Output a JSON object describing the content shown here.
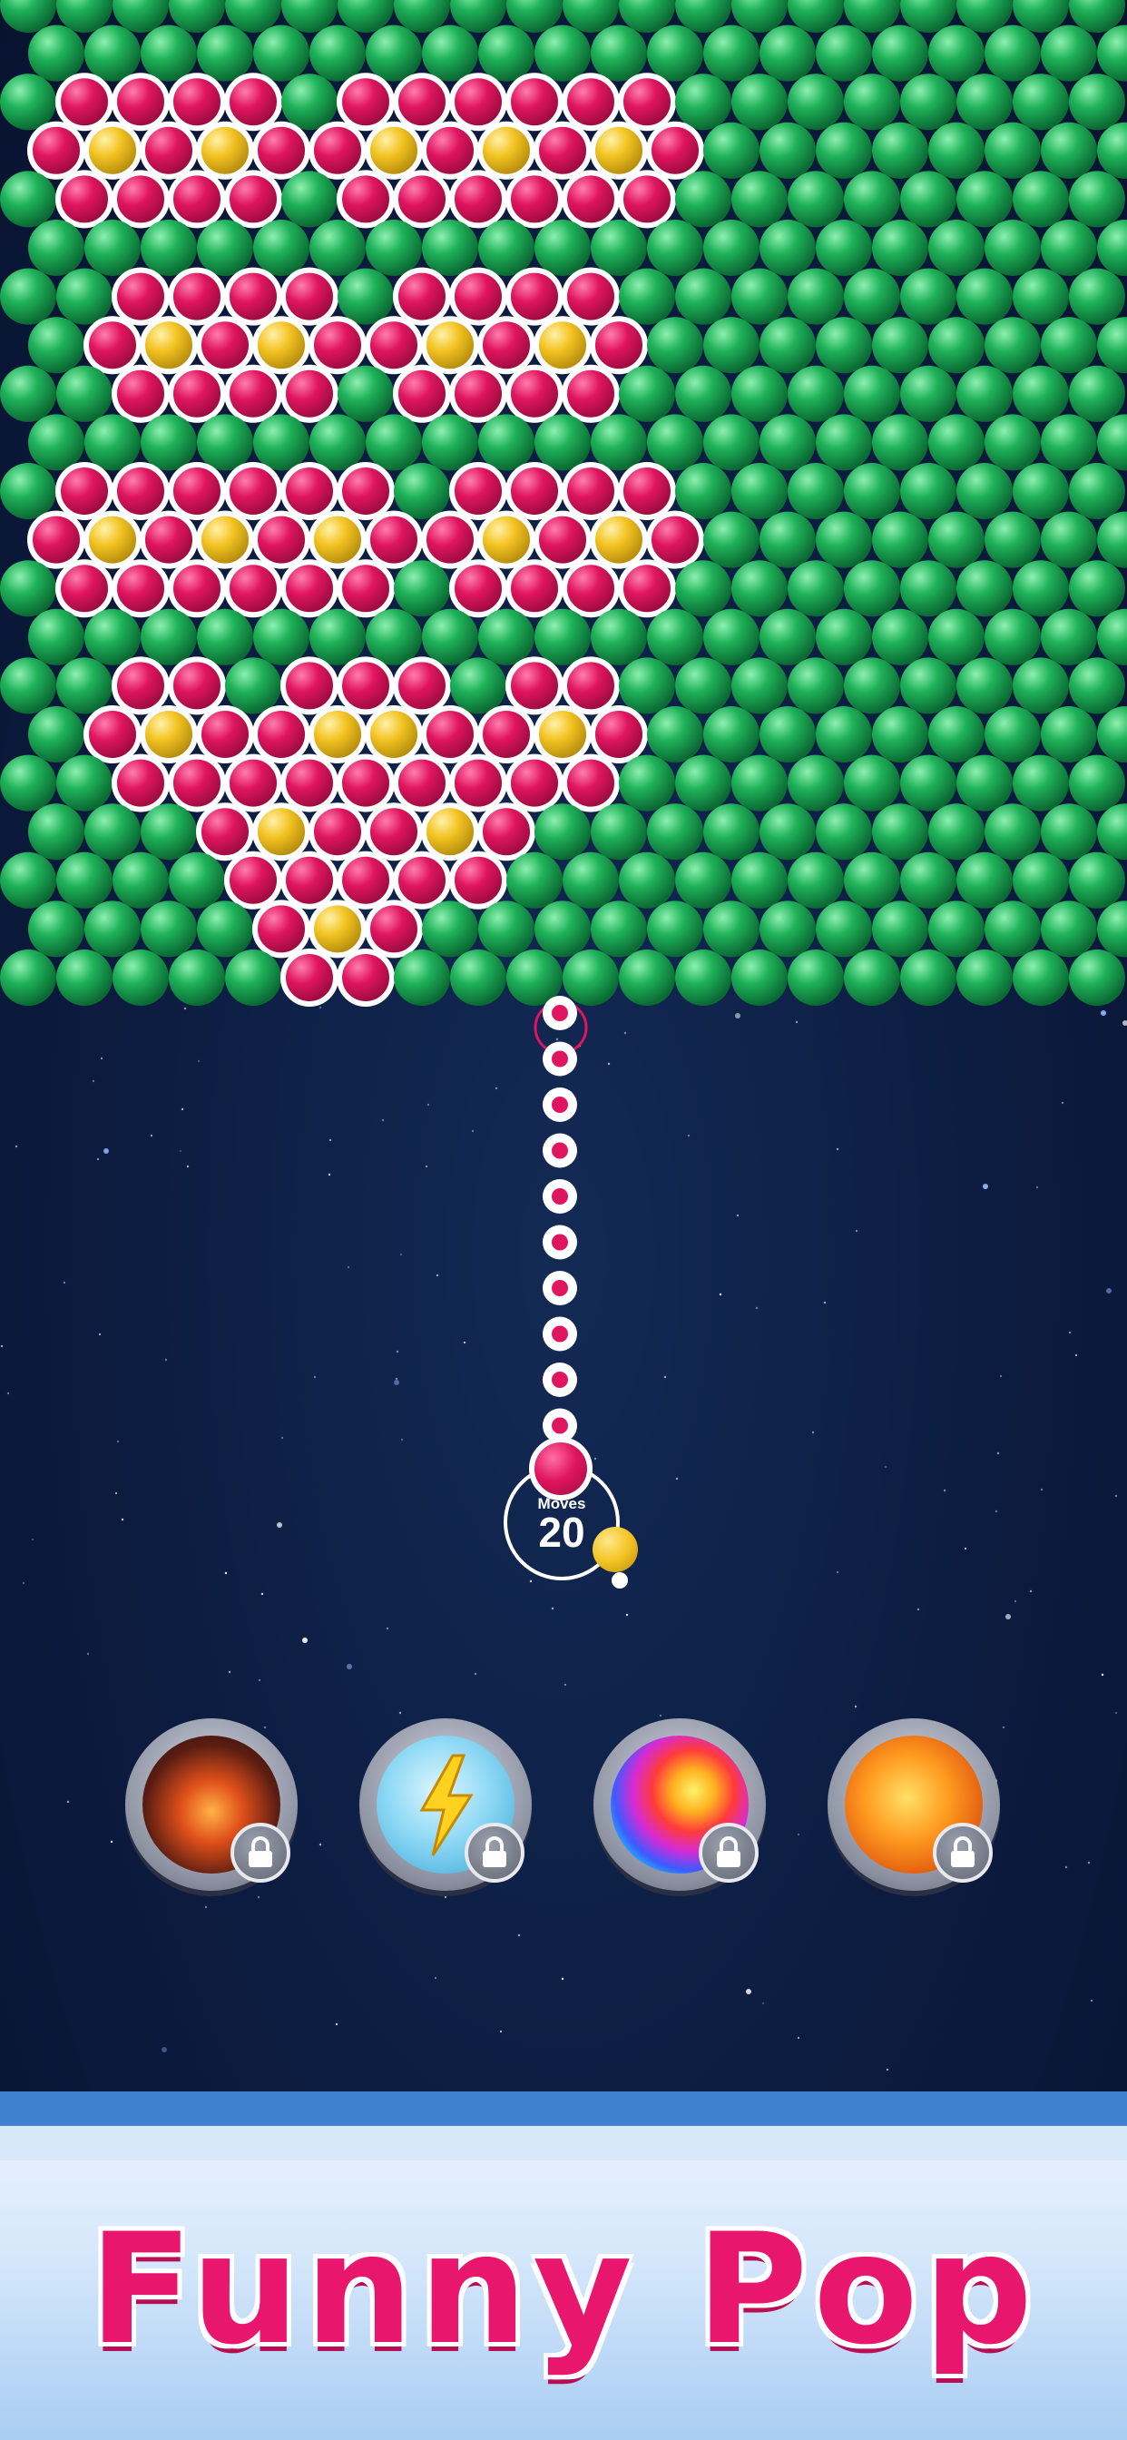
{
  "game": {
    "moves_label": "Moves",
    "moves_value": "20",
    "shooter_color": "pink",
    "next_ball_color": "yellow",
    "board": {
      "bubble_colors": {
        "green": "#1fb25a",
        "pink": "#e0155f",
        "yellow": "#f3c322"
      },
      "pattern": "pink-and-yellow flowers on green bubble field"
    }
  },
  "boosters": [
    {
      "name": "bomb",
      "icon": "bomb-icon",
      "locked": true
    },
    {
      "name": "lightning",
      "icon": "lightning-icon",
      "locked": true
    },
    {
      "name": "rainbow",
      "icon": "rainbow-ball-icon",
      "locked": true
    },
    {
      "name": "fireball",
      "icon": "fireball-icon",
      "locked": true
    }
  ],
  "banner": {
    "title": "Funny Pop"
  }
}
